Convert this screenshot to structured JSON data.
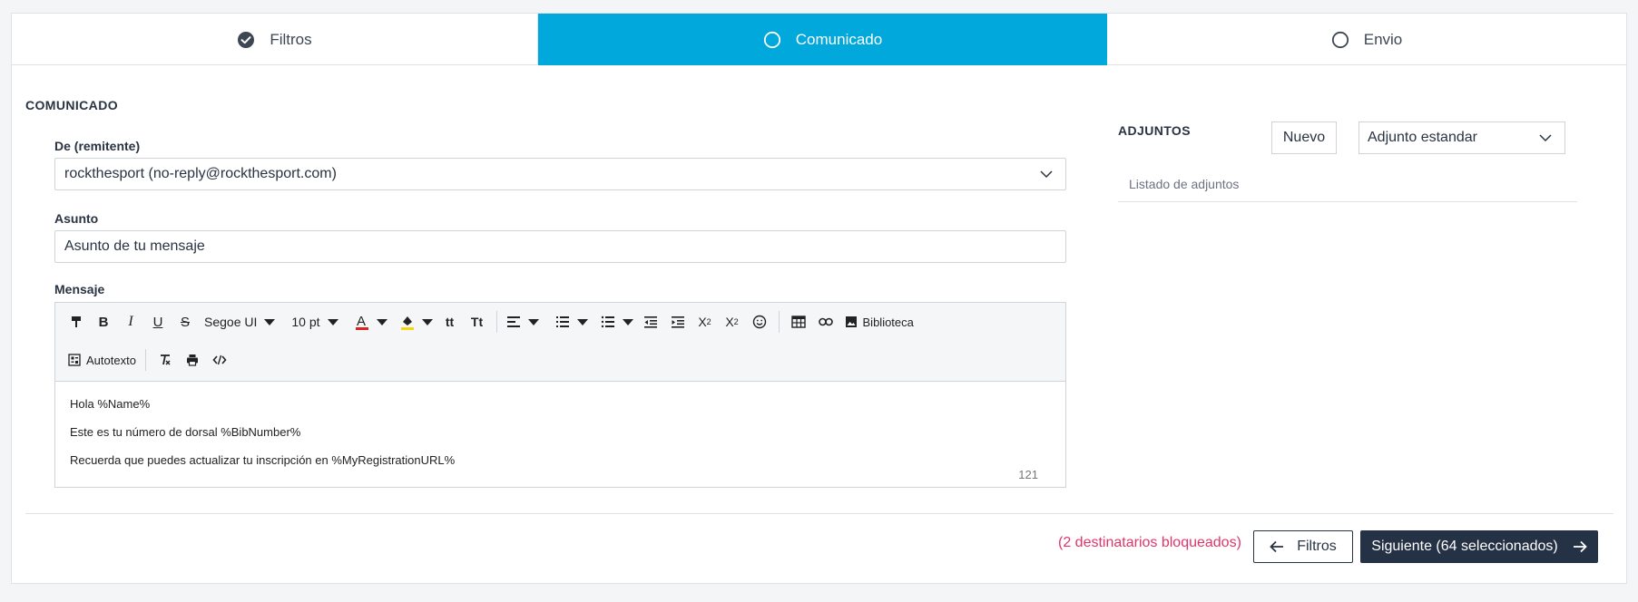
{
  "stepper": {
    "steps": [
      {
        "label": "Filtros",
        "state": "done"
      },
      {
        "label": "Comunicado",
        "state": "active"
      },
      {
        "label": "Envio",
        "state": "pending"
      }
    ]
  },
  "form": {
    "section_title": "COMUNICADO",
    "sender_label": "De (remitente)",
    "sender_value": "rockthesport (no-reply@rockthesport.com)",
    "subject_label": "Asunto",
    "subject_value": "Asunto de tu mensaje",
    "message_label": "Mensaje"
  },
  "editor": {
    "font_family": "Segoe UI",
    "font_size": "10 pt",
    "library_label": "Biblioteca",
    "autotext_label": "Autotexto",
    "lines": [
      "Hola %Name%",
      "Este es tu número de dorsal %BibNumber%",
      "Recuerda que puedes actualizar tu inscripción en %MyRegistrationURL%"
    ],
    "char_count": "121"
  },
  "attachments": {
    "title": "ADJUNTOS",
    "new_button": "Nuevo",
    "type_select": "Adjunto estandar",
    "list_label": "Listado de adjuntos"
  },
  "footer": {
    "blocked_text": "(2 destinatarios bloqueados)",
    "back_label": "Filtros",
    "next_label": "Siguiente (64 seleccionados)"
  },
  "colors": {
    "accent": "#00a8dc",
    "primary_button": "#253245",
    "warning_text": "#e0356b"
  }
}
